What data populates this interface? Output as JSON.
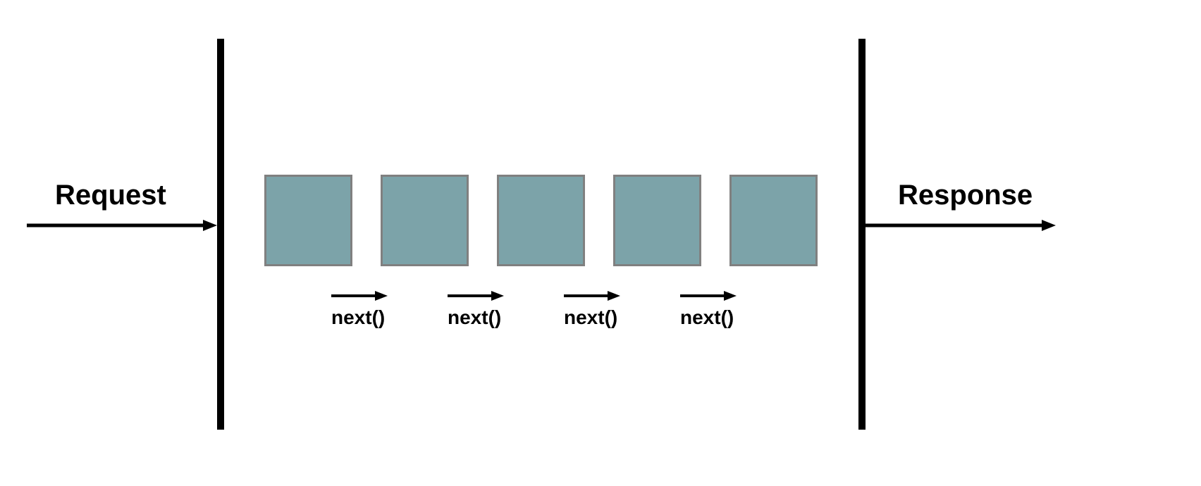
{
  "labels": {
    "request": "Request",
    "response": "Response",
    "next": "next()"
  },
  "colors": {
    "box_fill": "#7ca3a9",
    "box_border": "#808080",
    "line": "#000000"
  },
  "diagram": {
    "description": "Middleware pipeline: a Request enters on the left, passes through a sequence of five middleware boxes (each calling next() to hand off to the following one), and a Response exits on the right.",
    "middleware_count": 5,
    "next_calls": 4
  }
}
